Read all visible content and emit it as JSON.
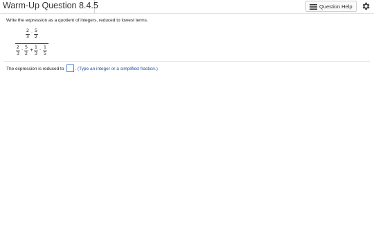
{
  "header": {
    "title": "Warm-Up Question 8.4.5",
    "help_label": "Question Help"
  },
  "question": {
    "instruction": "Write the expression as a quotient of integers, reduced to lowest terms.",
    "numerator": [
      {
        "num": "2",
        "den": "3"
      },
      {
        "op": "·"
      },
      {
        "num": "5",
        "den": "2"
      }
    ],
    "denominator": [
      {
        "num": "2",
        "den": "3"
      },
      {
        "op": "·"
      },
      {
        "num": "5",
        "den": "2"
      },
      {
        "op": "+"
      },
      {
        "num": "1",
        "den": "3"
      },
      {
        "op": "·"
      },
      {
        "num": "1",
        "den": "5"
      }
    ]
  },
  "answer": {
    "prefix": "The expression is reduced to",
    "value": "",
    "suffix": ".",
    "hint": "(Type an integer or a simplified fraction.)"
  },
  "icons": {
    "help": "list-icon",
    "settings": "gear-icon"
  }
}
